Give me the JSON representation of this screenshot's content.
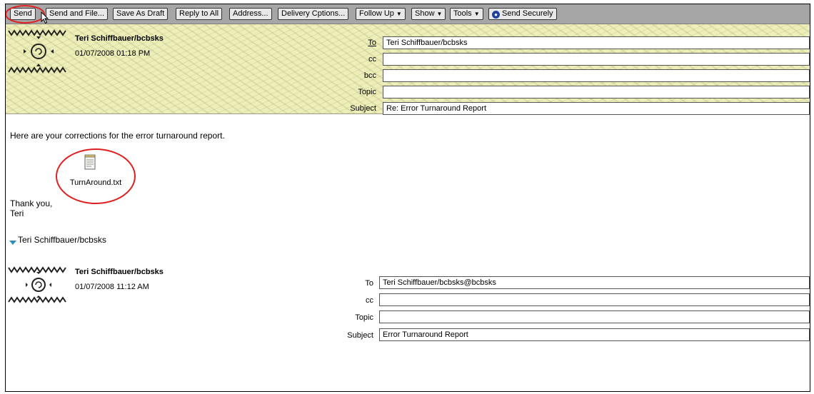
{
  "toolbar": {
    "send": "Send",
    "send_and_file": "Send and File...",
    "save_as_draft": "Save As Draft",
    "reply_to_all": "Reply to All",
    "address": "Address...",
    "delivery_options": "Delivery Cptions...",
    "follow_up": "Follow Up",
    "show": "Show",
    "tools": "Tools",
    "send_securely": "Send Securely"
  },
  "reply": {
    "sender": "Teri Schiffbauer/bcbsks",
    "date": "01/07/2008 01:18 PM",
    "labels": {
      "to": "To",
      "cc": "cc",
      "bcc": "bcc",
      "topic": "Topic",
      "subject": "Subject"
    },
    "to": "Teri Schiffbauer/bcbsks",
    "cc": "",
    "bcc": "",
    "topic": "",
    "subject": "Re: Error Turnaround Report"
  },
  "body": {
    "intro": "Here are your corrections for the error turnaround report.",
    "attachment": "TurnAround.txt",
    "thanks": "Thank you,",
    "signature": "Teri"
  },
  "thread_header": "Teri Schiffbauer/bcbsks",
  "original": {
    "sender": "Teri Schiffbauer/bcbsks",
    "date": "01/07/2008 11:12 AM",
    "labels": {
      "to": "To",
      "cc": "cc",
      "topic": "Topic",
      "subject": "Subject"
    },
    "to": "Teri Schiffbauer/bcbsks@bcbsks",
    "cc": "",
    "topic": "",
    "subject": "Error Turnaround Report"
  },
  "colors": {
    "toolbar": "#a6a6a6",
    "header_band": "#eeeeb8",
    "highlight_circle": "#e02020",
    "twisty": "#2a8fb8"
  }
}
